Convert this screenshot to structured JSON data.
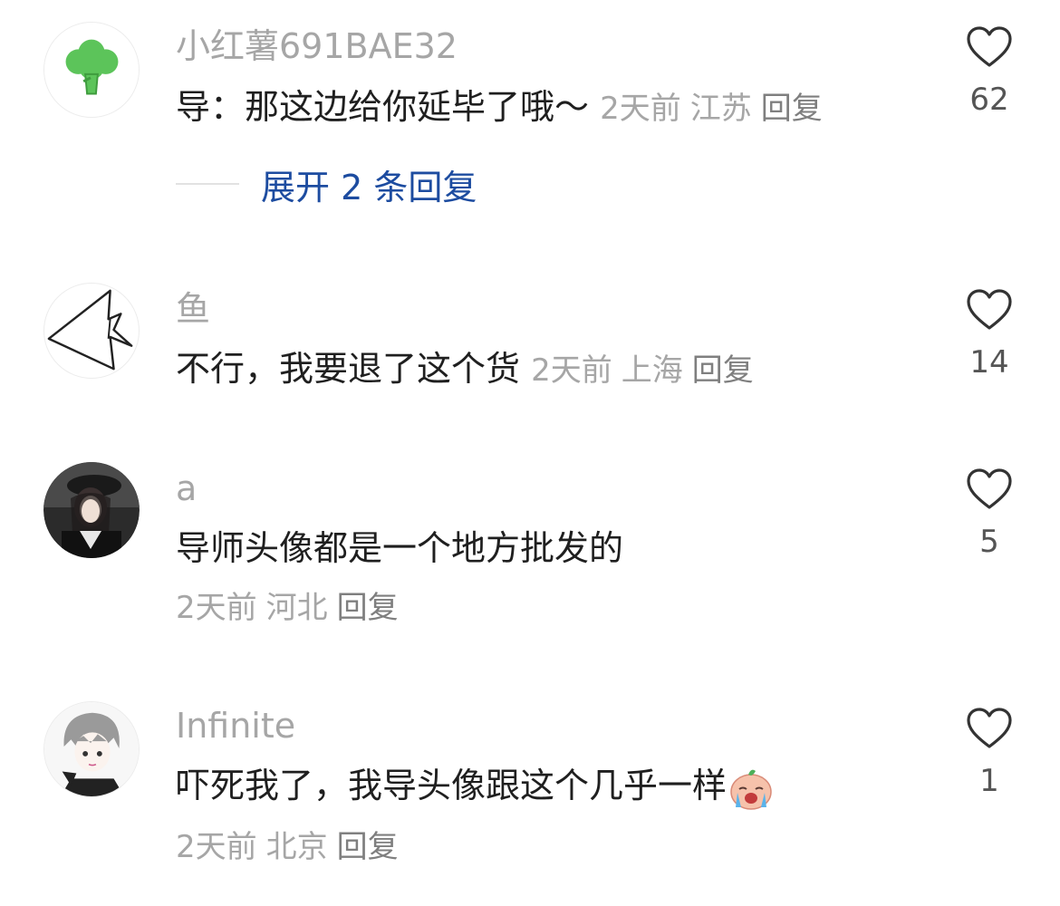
{
  "comments": [
    {
      "username": "小红薯691BAE32",
      "text": "导：那这边给你延毕了哦～",
      "time": "2天前",
      "location": "江苏",
      "reply_label": "回复",
      "likes": "62",
      "avatar": "broccoli-icon",
      "expand_label": "展开 2 条回复"
    },
    {
      "username": "鱼",
      "text": "不行，我要退了这个货",
      "time": "2天前",
      "location": "上海",
      "reply_label": "回复",
      "likes": "14",
      "avatar": "fish-sketch-icon"
    },
    {
      "username": "a",
      "text": "导师头像都是一个地方批发的",
      "time": "2天前",
      "location": "河北",
      "reply_label": "回复",
      "likes": "5",
      "avatar": "anime-girl-avatar"
    },
    {
      "username": "Infinite",
      "text": "吓死我了，我导头像跟这个几乎一样",
      "time": "2天前",
      "location": "北京",
      "reply_label": "回复",
      "likes": "1",
      "avatar": "anime-boy-avatar",
      "emoji": "crying-emoji"
    }
  ],
  "colors": {
    "username": "#a6a6a6",
    "text": "#1f1f1f",
    "expand_link": "#1d4ca0",
    "broccoli_green": "#5cc45a"
  }
}
